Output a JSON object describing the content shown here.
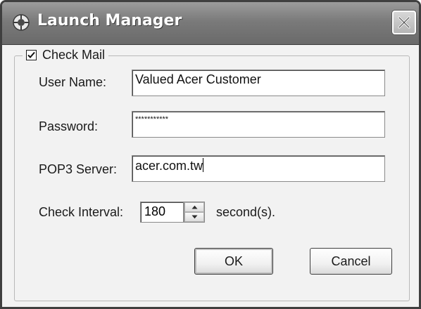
{
  "window": {
    "title": "Launch Manager",
    "icon": "launch-manager-app-icon",
    "close_icon": "close-icon"
  },
  "check_mail": {
    "label": "Check Mail",
    "checked": true
  },
  "fields": {
    "user_name_label": "User Name:",
    "user_name_value": "Valued Acer Customer",
    "password_label": "Password:",
    "password_value": "***********",
    "pop3_label": "POP3 Server:",
    "pop3_value": "acer.com.tw",
    "interval_label": "Check Interval:",
    "interval_value": "180",
    "interval_unit": "second(s)."
  },
  "buttons": {
    "ok_label": "OK",
    "cancel_label": "Cancel"
  }
}
